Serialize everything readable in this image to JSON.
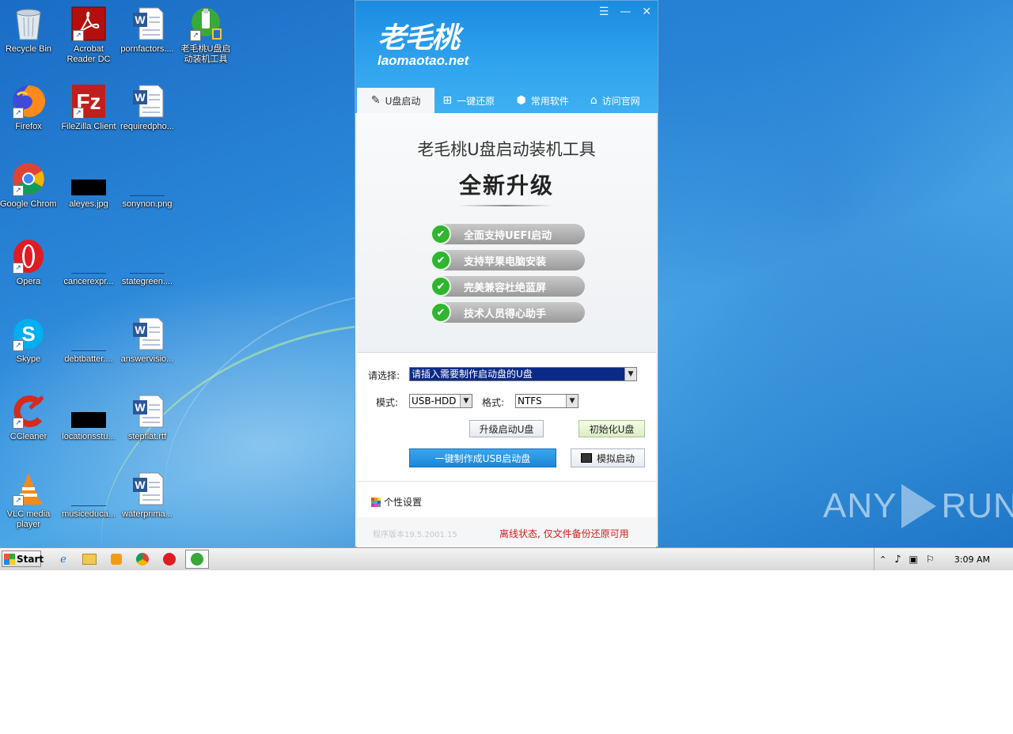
{
  "desktop": {
    "icons": [
      {
        "label": "Recycle Bin",
        "icon": "recycle-bin-icon"
      },
      {
        "label": "Acrobat Reader DC",
        "icon": "acrobat-icon"
      },
      {
        "label": "pornfactors....",
        "icon": "word-doc-icon"
      },
      {
        "label": "老毛桃U盘启动装机工具",
        "icon": "laomaotao-icon"
      },
      {
        "label": "Firefox",
        "icon": "firefox-icon"
      },
      {
        "label": "FileZilla Client",
        "icon": "filezilla-icon"
      },
      {
        "label": "requiredpho...",
        "icon": "word-doc-icon"
      },
      {
        "label": "Google Chrome",
        "icon": "chrome-icon"
      },
      {
        "label": "aleyes.jpg",
        "icon": "image-file-icon"
      },
      {
        "label": "sonynon.png",
        "icon": "image-file-icon"
      },
      {
        "label": "Opera",
        "icon": "opera-icon"
      },
      {
        "label": "cancerexpr...",
        "icon": "blank-file-icon"
      },
      {
        "label": "stategreen....",
        "icon": "blank-file-icon"
      },
      {
        "label": "Skype",
        "icon": "skype-icon"
      },
      {
        "label": "debtbatter....",
        "icon": "blank-file-icon"
      },
      {
        "label": "answervisio...",
        "icon": "word-doc-icon"
      },
      {
        "label": "CCleaner",
        "icon": "ccleaner-icon"
      },
      {
        "label": "locationsstu...",
        "icon": "image-file-icon"
      },
      {
        "label": "stepflat.rtf",
        "icon": "word-doc-icon"
      },
      {
        "label": "VLC media player",
        "icon": "vlc-icon"
      },
      {
        "label": "musiceduca...",
        "icon": "blank-file-icon"
      },
      {
        "label": "waterprima...",
        "icon": "word-doc-icon"
      }
    ]
  },
  "app": {
    "logo_cn": "老毛桃",
    "logo_en": "laomaotao.net",
    "window_buttons": {
      "menu": "☰",
      "minimize": "—",
      "close": "✕"
    },
    "tabs": [
      {
        "label": "U盘启动",
        "icon": "usb-drive-icon"
      },
      {
        "label": "一键还原",
        "icon": "windows-icon"
      },
      {
        "label": "常用软件",
        "icon": "box-icon"
      },
      {
        "label": "访问官网",
        "icon": "home-icon"
      }
    ],
    "headline": "老毛桃U盘启动装机工具",
    "upgrade": "全新升级",
    "features": [
      "全面支持UEFI启动",
      "支持苹果电脑安装",
      "完美兼容杜绝蓝屏",
      "技术人员得心助手"
    ],
    "form": {
      "select_label": "请选择:",
      "select_value": "请插入需要制作启动盘的U盘",
      "mode_label": "模式:",
      "mode_value": "USB-HDD",
      "format_label": "格式:",
      "format_value": "NTFS"
    },
    "buttons": {
      "upgrade_usb": "升级启动U盘",
      "init_usb": "初始化U盘",
      "make_usb": "一键制作成USB启动盘",
      "simulate": "模拟启动"
    },
    "personal_settings": "个性设置",
    "version": "程序版本19.5.2001.15",
    "offline_status": "离线状态, 仅文件备份还原可用"
  },
  "taskbar": {
    "start_label": "Start",
    "clock": "3:09 AM"
  },
  "watermark": {
    "left": "ANY",
    "right": "RUN"
  }
}
